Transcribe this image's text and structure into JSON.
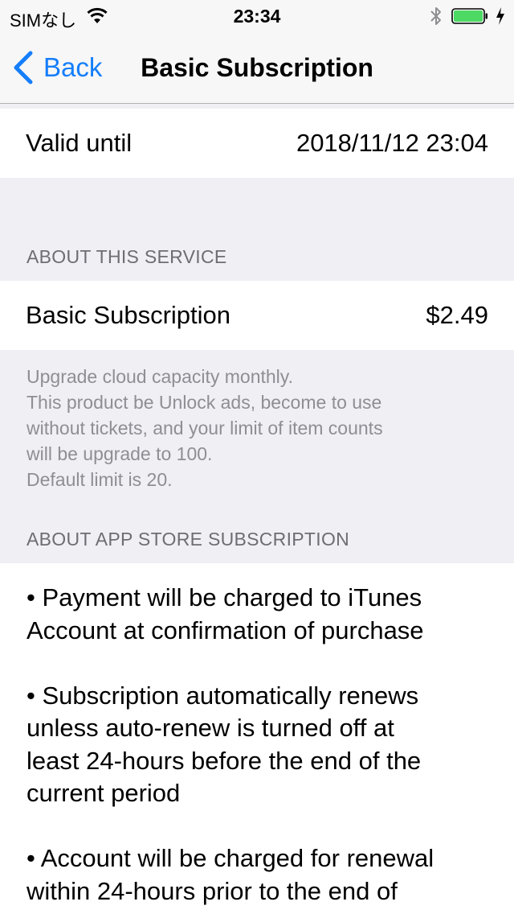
{
  "status_bar": {
    "carrier": "SIMなし",
    "time": "23:34",
    "battery_fill": 1.0,
    "battery_color": "#4cd964"
  },
  "nav": {
    "back_label": "Back",
    "title": "Basic Subscription",
    "tint_color": "#157efb"
  },
  "valid": {
    "label": "Valid until",
    "value": "2018/11/12 23:04"
  },
  "about_service": {
    "header": "ABOUT THIS SERVICE",
    "product_name": "Basic Subscription",
    "price": "$2.49",
    "footer_lines": [
      "Upgrade cloud capacity monthly.",
      "This product be Unlock ads, become to use",
      "without tickets, and your limit of item counts",
      "will be upgrade to 100.",
      "Default limit is 20."
    ]
  },
  "app_store": {
    "header": "ABOUT APP STORE SUBSCRIPTION",
    "terms_text": "• Payment will be charged to iTunes\nAccount at confirmation of purchase\n\n• Subscription automatically renews\nunless auto-renew is turned off at\nleast 24-hours before the end of the\ncurrent period\n\n• Account will be charged for renewal\nwithin 24-hours prior to the end of"
  }
}
